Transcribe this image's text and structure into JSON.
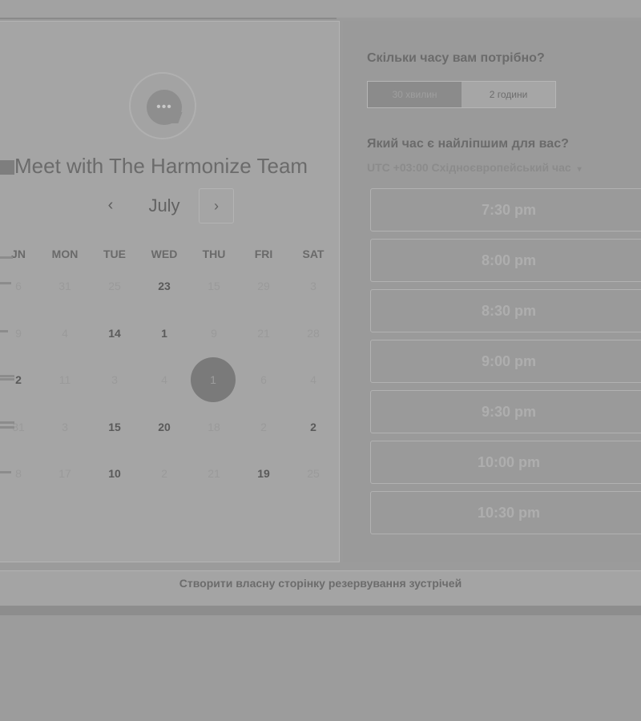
{
  "calendar": {
    "title": "Meet with The Harmonize Team",
    "month": "July",
    "prev_icon": "‹",
    "next_icon": "›",
    "weekdays": [
      "JN",
      "MON",
      "TUE",
      "WED",
      "THU",
      "FRI",
      "SAT"
    ],
    "weeks": [
      [
        "6",
        "31",
        "25",
        "23",
        "15",
        "29",
        "3"
      ],
      [
        "9",
        "4",
        "14",
        "1",
        "9",
        "21",
        "28"
      ],
      [
        "2",
        "11",
        "3",
        "4",
        "1",
        "6",
        "4"
      ],
      [
        "31",
        "3",
        "15",
        "20",
        "18",
        "2",
        "2"
      ],
      [
        "8",
        "17",
        "10",
        "2",
        "21",
        "19",
        "25"
      ]
    ],
    "bold_days": [
      [
        0,
        3
      ],
      [
        1,
        2
      ],
      [
        1,
        3
      ],
      [
        2,
        0
      ],
      [
        3,
        2
      ],
      [
        3,
        3
      ],
      [
        3,
        6
      ],
      [
        4,
        2
      ],
      [
        4,
        5
      ]
    ],
    "selected": {
      "row": 2,
      "col": 4
    }
  },
  "duration": {
    "question": "Скільки часу вам потрібно?",
    "options": [
      "30 хвилин",
      "2 години"
    ],
    "selected_index": 1
  },
  "time": {
    "question": "Який час є найліпшим для вас?",
    "timezone": "UTC +03:00 Східноєвропейський час",
    "slots": [
      "7:30 pm",
      "8:00 pm",
      "8:30 pm",
      "9:00 pm",
      "9:30 pm",
      "10:00 pm",
      "10:30 pm"
    ]
  },
  "footer": {
    "link": "Створити власну сторінку резервування зустрічей"
  }
}
